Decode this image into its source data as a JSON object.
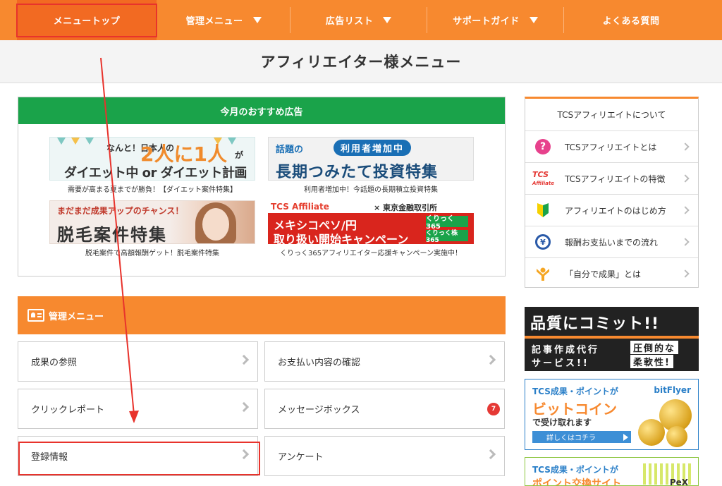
{
  "nav": {
    "items": [
      {
        "label": "メニュートップ"
      },
      {
        "label": "管理メニュー"
      },
      {
        "label": "広告リスト"
      },
      {
        "label": "サポートガイド"
      },
      {
        "label": "よくある質問"
      }
    ]
  },
  "page": {
    "title": "アフィリエイター様メニュー"
  },
  "recommended": {
    "header": "今月のおすすめ広告",
    "ads": [
      {
        "caption": "需要が高まる夏までが勝負！【ダイエット案件特集】",
        "banner": {
          "line1": "なんと！日本人の",
          "big": "2人に1人",
          "suffix": "が",
          "line2": "ダイエット中 or ダイエット計画中"
        }
      },
      {
        "caption": "利用者増加中！今話題の長期積立投資特集",
        "banner": {
          "topic": "話題の",
          "pill": "利用者増加中",
          "line2": "長期つみたて投資特集"
        }
      },
      {
        "caption": "脱毛案件で高額報酬ゲット！脱毛案件特集",
        "banner": {
          "line1": "まだまだ成果アップのチャンス！",
          "line2": "脱毛案件特集"
        }
      },
      {
        "caption": "くりっく365アフィリエイター応援キャンペーン実施中！",
        "banner": {
          "brand": "TCS Affiliate",
          "partner": "× 東京金融取引所",
          "line2": "メキシコペソ/円",
          "line3": "取り扱い開始キャンペーン",
          "logo1": "くりっく365",
          "logo2": "くりっく株365"
        }
      }
    ]
  },
  "management": {
    "header": "管理メニュー",
    "tiles": [
      {
        "label": "成果の参照"
      },
      {
        "label": "お支払い内容の確認"
      },
      {
        "label": "クリックレポート"
      },
      {
        "label": "メッセージボックス",
        "badge": "7"
      },
      {
        "label": "登録情報"
      },
      {
        "label": "アンケート"
      }
    ]
  },
  "sidebar": {
    "title": "TCSアフィリエイトについて",
    "items": [
      {
        "label": "TCSアフィリエイトとは",
        "icon": "question-icon"
      },
      {
        "label": "TCSアフィリエイトの特徴",
        "icon": "tcs-logo-icon",
        "icon_text": "TCS",
        "icon_sub": "Affiliate"
      },
      {
        "label": "アフィリエイトのはじめ方",
        "icon": "beginner-mark-icon"
      },
      {
        "label": "報酬お支払いまでの流れ",
        "icon": "yen-icon",
        "icon_text": "¥"
      },
      {
        "label": "「自分で成果」とは",
        "icon": "person-icon"
      }
    ]
  },
  "side_banners": {
    "quality": {
      "line1": "品質にコミット!!",
      "line2": "記事作成代行",
      "line3": "サービス!!",
      "box1": "圧倒的な",
      "box2": "柔軟性!"
    },
    "bitcoin": {
      "line1": "TCS成果・ポイントが",
      "brand": "bitFlyer",
      "line2": "ビットコイン",
      "line3": "で受け取れます",
      "button": "詳しくはコチラ"
    },
    "points": {
      "line1": "TCS成果・ポイントが",
      "line2": "ポイント交換サイト",
      "brand": "PeX"
    }
  },
  "colors": {
    "accent": "#f7892f",
    "highlight": "#e8332c",
    "green": "#1aa34a"
  }
}
